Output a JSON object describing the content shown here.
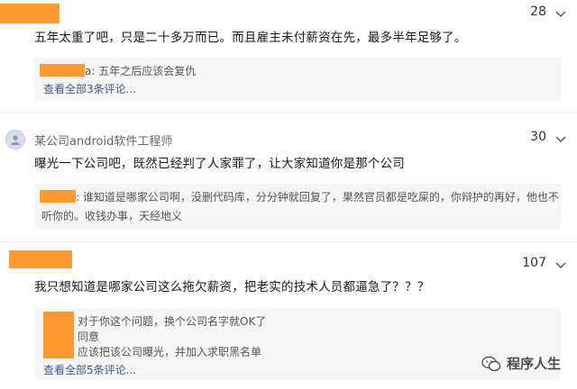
{
  "comments": [
    {
      "likes": "28",
      "body": "五年太重了吧，只是二十多万而已。而且雇主未付薪资在先，最多半年足够了。",
      "replies": [
        {
          "text": "a: 五年之后应该会复仇"
        }
      ],
      "view_all": "查看全部3条评论..."
    },
    {
      "author": "某公司android软件工程师",
      "likes": "30",
      "body": "曝光一下公司吧，既然已经判了人家罪了，让大家知道你是那个公司",
      "replies": [
        {
          "text": ": 谁知道是哪家公司啊，没删代码库，分分钟就回复了，果然官员都是吃屎的，你辩护的再好，他也不"
        },
        {
          "text": "听你的。收钱办事，天经地义"
        }
      ]
    },
    {
      "likes": "107",
      "body": "我只想知道是哪家公司这么拖欠薪资，把老实的技术人员都逼急了？？？",
      "replies": [
        {
          "text": "对于你这个问题，换个公司名字就OK了"
        },
        {
          "text": "同意"
        },
        {
          "text": "应该把该公司曝光，并加入求职黑名单"
        }
      ],
      "view_all": "查看全部5条评论..."
    }
  ],
  "brand": {
    "name": "程序人生"
  },
  "colors": {
    "redaction": "#ff9a33",
    "link": "#3b5b8f",
    "reply_bg": "#f6f6f6"
  }
}
